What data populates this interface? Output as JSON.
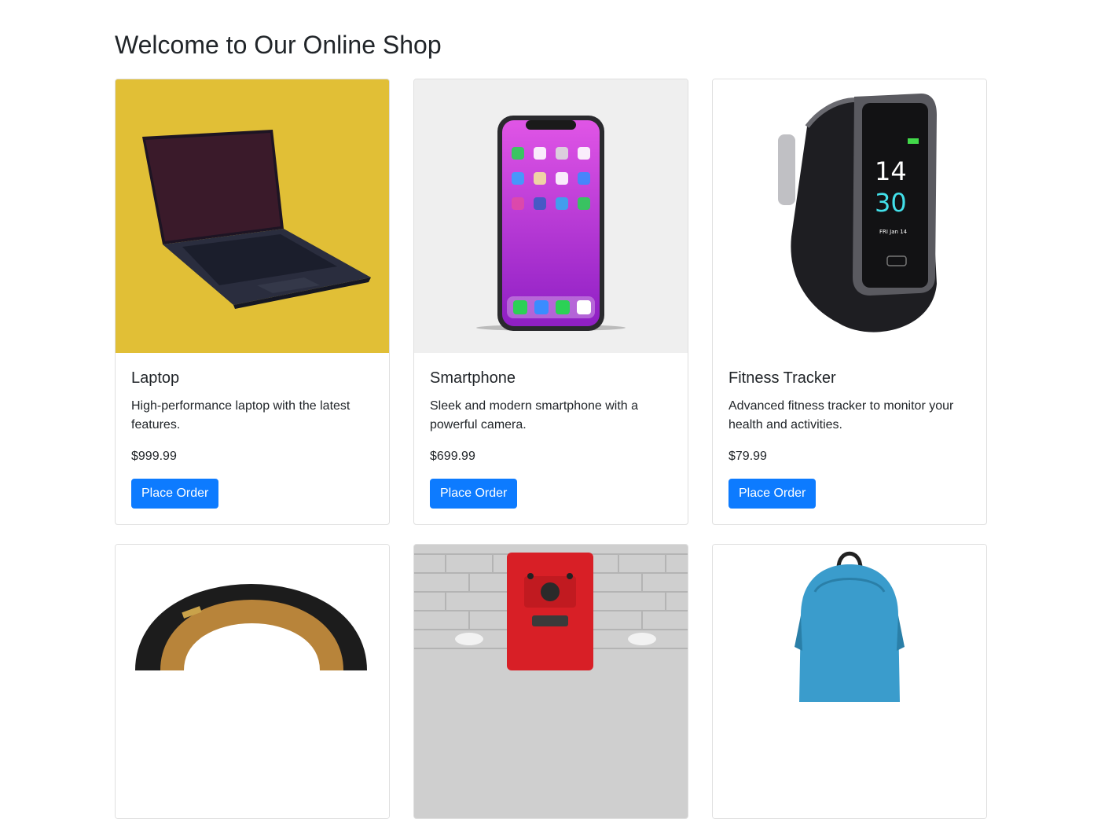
{
  "page": {
    "title": "Welcome to Our Online Shop"
  },
  "products": [
    {
      "name": "Laptop",
      "description": "High-performance laptop with the latest features.",
      "price": "$999.99",
      "button": "Place Order",
      "image": "laptop-image",
      "bg": "#e1bf36"
    },
    {
      "name": "Smartphone",
      "description": "Sleek and modern smartphone with a powerful camera.",
      "price": "$699.99",
      "button": "Place Order",
      "image": "smartphone-image",
      "bg": "#efefef"
    },
    {
      "name": "Fitness Tracker",
      "description": "Advanced fitness tracker to monitor your health and activities.",
      "price": "$79.99",
      "button": "Place Order",
      "image": "fitness-tracker-image",
      "bg": "#ffffff"
    },
    {
      "image": "headphones-image",
      "bg": "#ffffff"
    },
    {
      "image": "coffee-machine-image",
      "bg": "#cfcfcf"
    },
    {
      "image": "backpack-image",
      "bg": "#ffffff"
    }
  ],
  "watch_face": {
    "hour": "14",
    "minute": "30",
    "date": "FRI  Jan 14"
  }
}
